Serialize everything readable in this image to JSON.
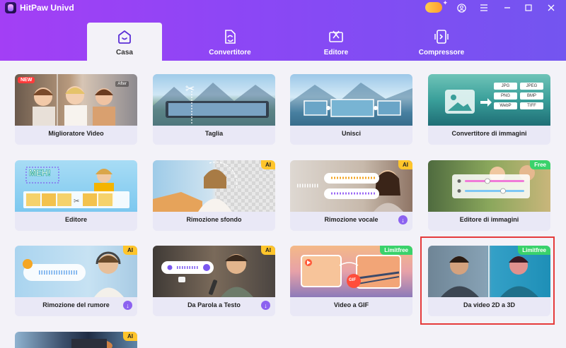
{
  "app": {
    "title": "HitPaw Univd"
  },
  "tabs": [
    {
      "label": "Casa",
      "icon": "home-icon",
      "active": true
    },
    {
      "label": "Convertitore",
      "icon": "convert-icon"
    },
    {
      "label": "Editore",
      "icon": "editor-icon"
    },
    {
      "label": "Compressore",
      "icon": "compress-icon"
    }
  ],
  "tools": [
    {
      "label": "Miglioratore Video",
      "badge": "NEW",
      "thumb_text": "After"
    },
    {
      "label": "Taglia"
    },
    {
      "label": "Unisci"
    },
    {
      "label": "Convertitore di immagini",
      "formats": [
        "JPG",
        "JPEG",
        "PNG",
        "BMP",
        "WebP",
        "TIFF"
      ]
    },
    {
      "label": "Editore",
      "thumb_text": "MEH!"
    },
    {
      "label": "Rimozione sfondo",
      "badge": "AI"
    },
    {
      "label": "Rimozione vocale",
      "badge": "AI"
    },
    {
      "label": "Editore di immagini",
      "badge": "Free"
    },
    {
      "label": "Rimozione del rumore",
      "badge": "AI"
    },
    {
      "label": "Da Parola a Testo",
      "badge": "AI"
    },
    {
      "label": "Video a GIF",
      "badge": "Limitfree",
      "thumb_text": "GIF"
    },
    {
      "label": "Da video 2D a 3D",
      "badge": "Limitfree"
    },
    {
      "label": "",
      "badge": "AI"
    }
  ],
  "colors": {
    "accent": "#8b47f5",
    "ai_badge": "#ffc52b",
    "free_badge": "#3ad26b",
    "highlight": "#e53b3b"
  }
}
